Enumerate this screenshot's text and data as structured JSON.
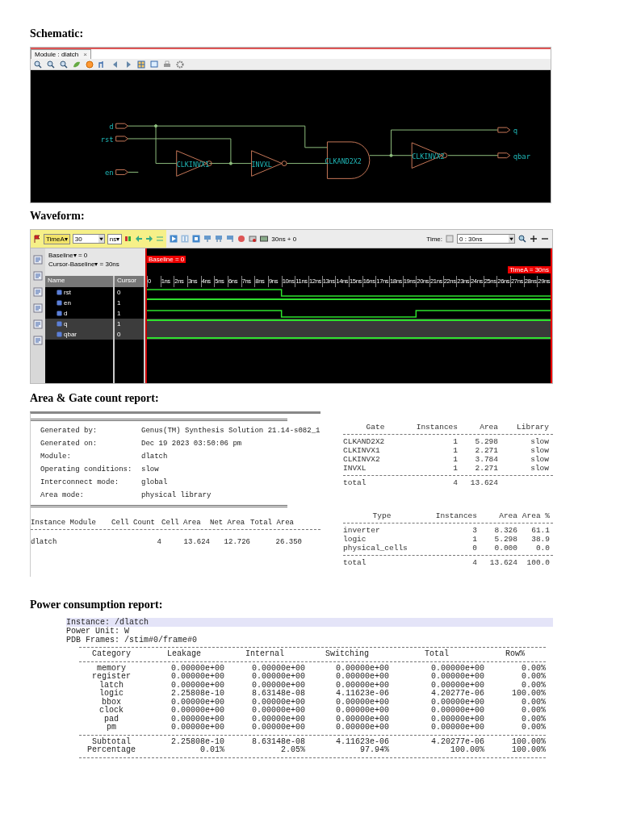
{
  "schematic": {
    "heading": "Schematic:",
    "tab": "Module : dlatch",
    "tab_close": "×",
    "ports": [
      {
        "name": "d",
        "kind": "input"
      },
      {
        "name": "rst",
        "kind": "input"
      },
      {
        "name": "en",
        "kind": "input"
      },
      {
        "name": "q",
        "kind": "output"
      },
      {
        "name": "qbar",
        "kind": "output"
      }
    ],
    "gates": [
      {
        "label": "CLKINVX1",
        "kind": "inverter"
      },
      {
        "label": "INVXL",
        "kind": "inverter"
      },
      {
        "label": "CLKAND2X2",
        "kind": "and"
      },
      {
        "label": "CLKINVX2",
        "kind": "inverter"
      }
    ]
  },
  "waveform": {
    "heading": "Waveform:",
    "marker": "TimeA▾",
    "time_value": "30",
    "unit": "ns▾",
    "delta": "30ns + 0",
    "time_label": "Time:",
    "time_range": "0 : 30ns",
    "baseline_info": "Baseline▾ = 0",
    "cursor_info": "Cursor-Baseline▾ = 30ns",
    "columns": [
      "Name",
      "Cursor"
    ],
    "baseline_flag": "Baseline = 0",
    "timea_flag": "TimeA = 30ns",
    "ticks": [
      "0",
      "1ns",
      "2ns",
      "3ns",
      "4ns",
      "5ns",
      "6ns",
      "7ns",
      "8ns",
      "9ns",
      "10ns",
      "11ns",
      "12ns",
      "13ns",
      "14ns",
      "15ns",
      "16ns",
      "17ns",
      "18ns",
      "19ns",
      "20ns",
      "21ns",
      "22ns",
      "23ns",
      "24ns",
      "25ns",
      "26ns",
      "27ns",
      "28ns",
      "29ns"
    ],
    "signals": [
      {
        "name": "rst",
        "value": "0",
        "selected": false
      },
      {
        "name": "en",
        "value": "1",
        "selected": false
      },
      {
        "name": "d",
        "value": "1",
        "selected": false
      },
      {
        "name": "q",
        "value": "1",
        "selected": true
      },
      {
        "name": "qbar",
        "value": "0",
        "selected": true
      }
    ]
  },
  "area": {
    "heading": "Area & Gate count report:",
    "info": [
      {
        "label": "Generated by:",
        "value": "Genus(TM) Synthesis Solution 21.14-s082_1"
      },
      {
        "label": "Generated on:",
        "value": "Dec 19 2023  03:50:06 pm"
      },
      {
        "label": "Module:",
        "value": "dlatch"
      },
      {
        "label": "Operating conditions:",
        "value": "slow"
      },
      {
        "label": "Interconnect mode:",
        "value": "global"
      },
      {
        "label": "Area mode:",
        "value": "physical library"
      }
    ],
    "columns": [
      "Instance Module",
      "Cell Count",
      "Cell Area",
      "Net Area",
      "Total Area"
    ],
    "rows": [
      [
        "dlatch",
        "4",
        "13.624",
        "12.726",
        "26.350"
      ]
    ],
    "gates": {
      "columns": [
        "Gate",
        "Instances",
        "Area",
        "Library"
      ],
      "rows": [
        [
          "CLKAND2X2",
          "1",
          "5.298",
          "slow"
        ],
        [
          "CLKINVX1",
          "1",
          "2.271",
          "slow"
        ],
        [
          "CLKINVX2",
          "1",
          "3.784",
          "slow"
        ],
        [
          "INVXL",
          "1",
          "2.271",
          "slow"
        ]
      ],
      "total": [
        "total",
        "4",
        "13.624"
      ]
    },
    "types": {
      "columns": [
        "Type",
        "Instances",
        "Area",
        "Area %"
      ],
      "rows": [
        [
          "inverter",
          "3",
          "8.326",
          "61.1"
        ],
        [
          "logic",
          "1",
          "5.298",
          "38.9"
        ],
        [
          "physical_cells",
          "0",
          "0.000",
          "0.0"
        ]
      ],
      "total": [
        "total",
        "4",
        "13.624",
        "100.0"
      ]
    }
  },
  "power": {
    "heading": "Power consumption report:",
    "instance": "Instance: /dlatch",
    "unit": "Power Unit: W",
    "frames": "PDB Frames: /stim#0/frame#0",
    "columns": [
      "Category",
      "Leakage",
      "Internal",
      "Switching",
      "Total",
      "Row%"
    ],
    "rows": [
      [
        "memory",
        "0.00000e+00",
        "0.00000e+00",
        "0.00000e+00",
        "0.00000e+00",
        "0.00%"
      ],
      [
        "register",
        "0.00000e+00",
        "0.00000e+00",
        "0.00000e+00",
        "0.00000e+00",
        "0.00%"
      ],
      [
        "latch",
        "0.00000e+00",
        "0.00000e+00",
        "0.00000e+00",
        "0.00000e+00",
        "0.00%"
      ],
      [
        "logic",
        "2.25808e-10",
        "8.63148e-08",
        "4.11623e-06",
        "4.20277e-06",
        "100.00%"
      ],
      [
        "bbox",
        "0.00000e+00",
        "0.00000e+00",
        "0.00000e+00",
        "0.00000e+00",
        "0.00%"
      ],
      [
        "clock",
        "0.00000e+00",
        "0.00000e+00",
        "0.00000e+00",
        "0.00000e+00",
        "0.00%"
      ],
      [
        "pad",
        "0.00000e+00",
        "0.00000e+00",
        "0.00000e+00",
        "0.00000e+00",
        "0.00%"
      ],
      [
        "pm",
        "0.00000e+00",
        "0.00000e+00",
        "0.00000e+00",
        "0.00000e+00",
        "0.00%"
      ]
    ],
    "summary": [
      [
        "Subtotal",
        "2.25808e-10",
        "8.63148e-08",
        "4.11623e-06",
        "4.20277e-06",
        "100.00%"
      ],
      [
        "Percentage",
        "0.01%",
        "2.05%",
        "97.94%",
        "100.00%",
        "100.00%"
      ]
    ]
  }
}
